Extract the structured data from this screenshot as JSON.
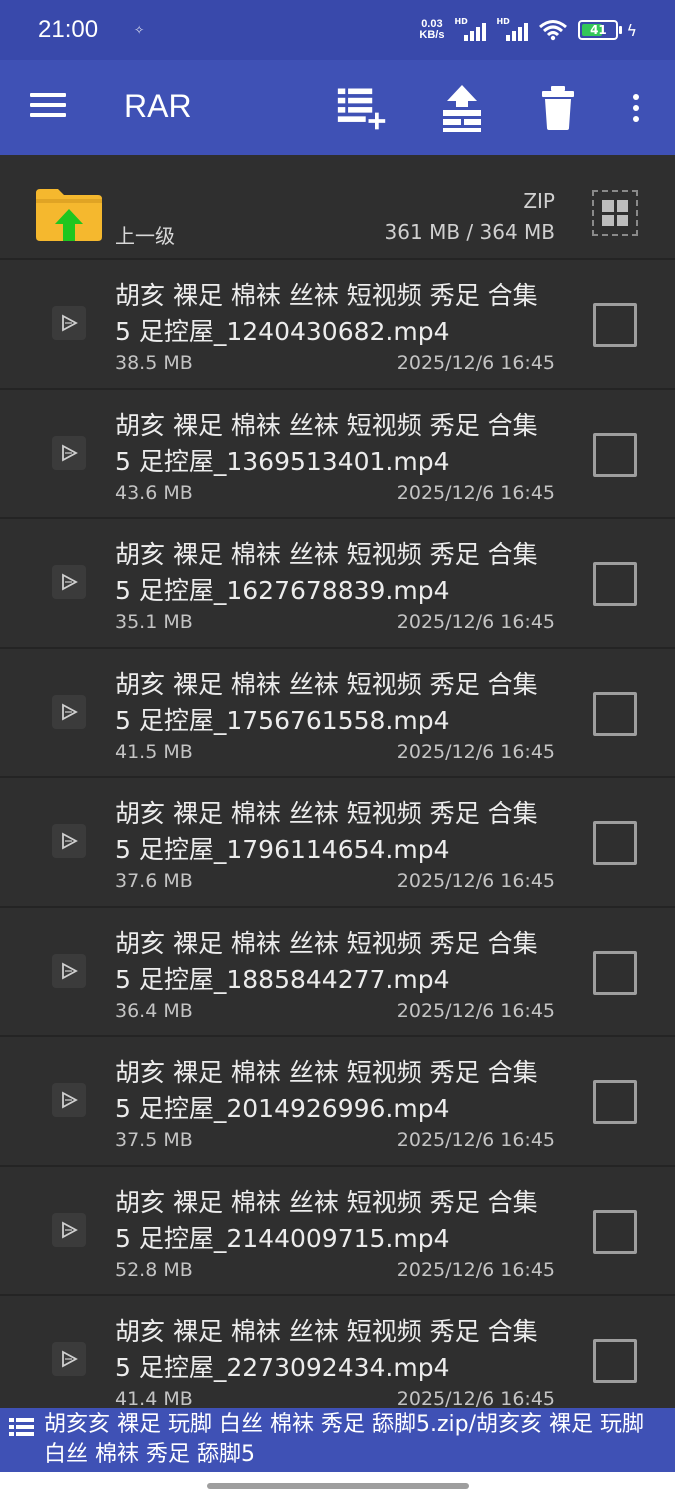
{
  "status_bar": {
    "time": "21:00",
    "net_speed_value": "0.03",
    "net_speed_unit": "KB/s",
    "signal_label_1": "HD",
    "signal_label_2": "HD",
    "battery_level": "41"
  },
  "app_bar": {
    "title": "RAR",
    "icons": [
      "menu-icon",
      "add-to-archive-icon",
      "extract-icon",
      "delete-icon",
      "more-vert-icon"
    ]
  },
  "parent_row": {
    "label": "上一级",
    "archive_type": "ZIP",
    "size_summary": "361 MB / 364 MB"
  },
  "files": [
    {
      "name": "胡亥 裸足 棉袜 丝袜 短视频 秀足 合集 5  足控屋_1240430682.mp4",
      "size": "38.5 MB",
      "date": "2025/12/6 16:45"
    },
    {
      "name": "胡亥 裸足 棉袜 丝袜 短视频 秀足 合集 5  足控屋_1369513401.mp4",
      "size": "43.6 MB",
      "date": "2025/12/6 16:45"
    },
    {
      "name": "胡亥 裸足 棉袜 丝袜 短视频 秀足 合集 5  足控屋_1627678839.mp4",
      "size": "35.1 MB",
      "date": "2025/12/6 16:45"
    },
    {
      "name": "胡亥 裸足 棉袜 丝袜 短视频 秀足 合集 5  足控屋_1756761558.mp4",
      "size": "41.5 MB",
      "date": "2025/12/6 16:45"
    },
    {
      "name": "胡亥 裸足 棉袜 丝袜 短视频 秀足 合集 5  足控屋_1796114654.mp4",
      "size": "37.6 MB",
      "date": "2025/12/6 16:45"
    },
    {
      "name": "胡亥 裸足 棉袜 丝袜 短视频 秀足 合集 5  足控屋_1885844277.mp4",
      "size": "36.4 MB",
      "date": "2025/12/6 16:45"
    },
    {
      "name": "胡亥 裸足 棉袜 丝袜 短视频 秀足 合集 5  足控屋_2014926996.mp4",
      "size": "37.5 MB",
      "date": "2025/12/6 16:45"
    },
    {
      "name": "胡亥 裸足 棉袜 丝袜 短视频 秀足 合集 5  足控屋_2144009715.mp4",
      "size": "52.8 MB",
      "date": "2025/12/6 16:45"
    },
    {
      "name": "胡亥 裸足 棉袜 丝袜 短视频 秀足 合集 5  足控屋_2273092434.mp4",
      "size": "41.4 MB",
      "date": "2025/12/6 16:45"
    }
  ],
  "path_bar": {
    "path": "胡亥亥 裸足 玩脚 白丝 棉袜 秀足 舔脚5.zip/胡亥亥 裸足 玩脚 白丝 棉袜 秀足 舔脚5"
  },
  "colors": {
    "app_bar": "#3f51b5",
    "status_bar": "#3949ab",
    "list_background": "#2f2f2f",
    "folder": "#f5b82e",
    "up_arrow": "#1fc61f"
  }
}
